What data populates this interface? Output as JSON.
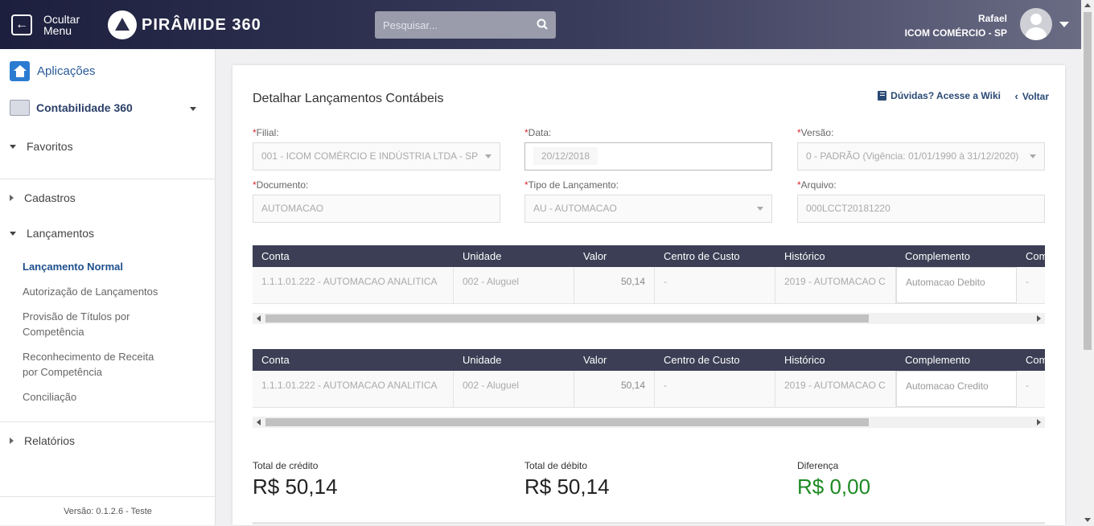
{
  "header": {
    "hide_menu_label": "Ocultar Menu",
    "brand": "PIRÂMIDE 360",
    "search_placeholder": "Pesquisar...",
    "user_name": "Rafael",
    "company": "ICOM COMÉRCIO - SP"
  },
  "sidebar": {
    "apps_label": "Aplicações",
    "module_label": "Contabilidade 360",
    "favorites": "Favoritos",
    "cadastros": "Cadastros",
    "lancamentos": "Lançamentos",
    "items": [
      "Lançamento Normal",
      "Autorização de Lançamentos",
      "Provisão de Títulos por Competência",
      "Reconhecimento de Receita por Competência",
      "Conciliação"
    ],
    "relatorios": "Relatórios",
    "version": "Versão: 0.1.2.6 - Teste"
  },
  "page": {
    "title": "Detalhar Lançamentos Contábeis",
    "wiki_link": "Dúvidas? Acesse a Wiki",
    "back_link": "Voltar",
    "required_mark": "*"
  },
  "form": {
    "filial": {
      "label": "Filial:",
      "value": "001 - ICOM COMÉRCIO E INDÚSTRIA LTDA - SP"
    },
    "data": {
      "label": "Data:",
      "value": "20/12/2018"
    },
    "versao": {
      "label": "Versão:",
      "value": "0 - PADRÃO (Vigência: 01/01/1990 à 31/12/2020)"
    },
    "documento": {
      "label": "Documento:",
      "value": "AUTOMACAO"
    },
    "tipo": {
      "label": "Tipo de Lançamento:",
      "value": "AU - AUTOMACAO"
    },
    "arquivo": {
      "label": "Arquivo:",
      "value": "000LCCT20181220"
    }
  },
  "tables": {
    "columns": [
      "Conta",
      "Unidade",
      "Valor",
      "Centro de Custo",
      "Histórico",
      "Complemento",
      "Com"
    ],
    "debit_row": [
      "1.1.1.01.222 - AUTOMACAO ANALITICA",
      "002 - Aluguel",
      "50,14",
      "-",
      "2019 - AUTOMACAO C",
      "Automacao Debito",
      "-"
    ],
    "credit_row": [
      "1.1.1.01.222 - AUTOMACAO ANALITICA",
      "002 - Aluguel",
      "50,14",
      "-",
      "2019 - AUTOMACAO C",
      "Automacao Credito",
      "-"
    ]
  },
  "totals": {
    "credit_label": "Total de crédito",
    "credit_value": "R$ 50,14",
    "debit_label": "Total de débito",
    "debit_value": "R$ 50,14",
    "diff_label": "Diferença",
    "diff_value": "R$ 0,00"
  },
  "colors": {
    "header_dark": "#1c1f3d",
    "table_header": "#3b3e54",
    "link": "#2a4a75",
    "positive": "#1e8a24",
    "required": "#d9272e"
  }
}
